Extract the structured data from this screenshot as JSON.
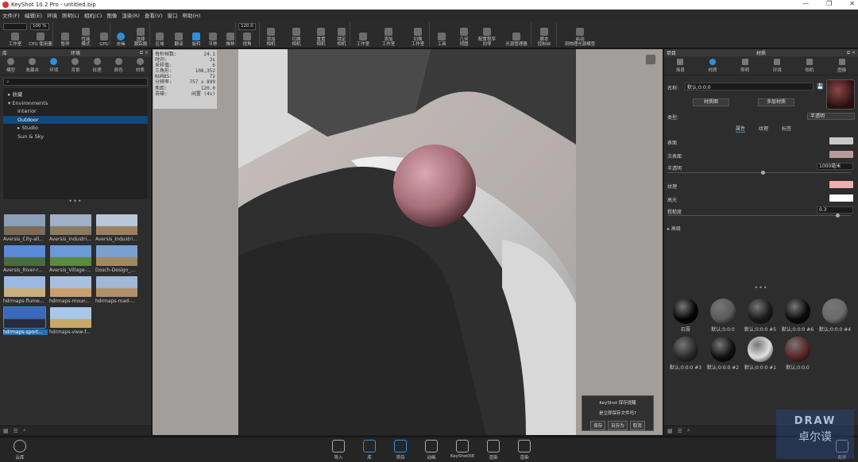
{
  "window": {
    "title": "KeyShot 10.2 Pro  -  untitled.bip",
    "controls": [
      "—",
      "❐",
      "✕"
    ]
  },
  "menu": [
    "文件(F)",
    "编辑(E)",
    "环境",
    "照明(L)",
    "相机(C)",
    "图像",
    "渲染(R)",
    "查看(V)",
    "窗口",
    "帮助(H)"
  ],
  "toolbar": {
    "fields": [
      "",
      "100 %",
      "120.0"
    ],
    "items": [
      {
        "label": "工作室"
      },
      {
        "label": "CPU 使用量"
      },
      {
        "label": "暂停"
      },
      {
        "label": "性能\n模式"
      },
      {
        "label": "GPU"
      },
      {
        "label": "去噪"
      },
      {
        "label": "选择\n跟踪器"
      },
      {
        "label": "区域"
      },
      {
        "label": "翻译"
      },
      {
        "label": "旋转"
      },
      {
        "label": "平移"
      },
      {
        "label": "推移"
      },
      {
        "label": "视角"
      },
      {
        "label": "添加\n相机"
      },
      {
        "label": "切换\n相机"
      },
      {
        "label": "重置\n相机"
      },
      {
        "label": "锁定\n相机"
      },
      {
        "label": "工作室"
      },
      {
        "label": "添加\n工作室"
      },
      {
        "label": "切换\n工作室"
      },
      {
        "label": "工具"
      },
      {
        "label": "几何\n视图"
      },
      {
        "label": "配置程序\n向导"
      },
      {
        "label": "光源管理器"
      },
      {
        "label": "脚本\n控制台"
      },
      {
        "label": "启动\n到物理光源模型"
      }
    ]
  },
  "library": {
    "title": "库",
    "section": "环境",
    "tabs": [
      {
        "label": "模型"
      },
      {
        "label": "收藏夹"
      },
      {
        "label": "环境"
      },
      {
        "label": "背景"
      },
      {
        "label": "纹理"
      },
      {
        "label": "颜色"
      },
      {
        "label": "材质"
      }
    ],
    "search_placeholder": "⌕",
    "tree": [
      {
        "label": "▸ 收藏",
        "level": 0
      },
      {
        "label": "▾ Environments",
        "level": 0
      },
      {
        "label": "Interior",
        "level": 1
      },
      {
        "label": "Outdoor",
        "level": 1,
        "selected": true
      },
      {
        "label": "▸ Studio",
        "level": 1
      },
      {
        "label": "Sun & Sky",
        "level": 1
      }
    ],
    "thumbnails": [
      {
        "label": "Aversis_City-all...",
        "colors": [
          "#8aa0b8",
          "#7a6a58"
        ]
      },
      {
        "label": "Aversis_Industri...",
        "colors": [
          "#9fb0c8",
          "#8a7a60"
        ]
      },
      {
        "label": "Aversis_Industri...",
        "colors": [
          "#b8c8d8",
          "#9a8060"
        ]
      },
      {
        "label": "Aversis_River-r...",
        "colors": [
          "#5a8ad8",
          "#4a6a40"
        ]
      },
      {
        "label": "Aversis_Village-...",
        "colors": [
          "#6a9ad8",
          "#5a8a40"
        ]
      },
      {
        "label": "Dosch-Design_...",
        "colors": [
          "#7aa0d0",
          "#a08a60"
        ]
      },
      {
        "label": "hdrmaps-flume...",
        "colors": [
          "#9ab8e0",
          "#c8b080"
        ]
      },
      {
        "label": "hdrmaps-moun...",
        "colors": [
          "#a8c0e0",
          "#c8a070"
        ]
      },
      {
        "label": "hdrmaps-road-...",
        "colors": [
          "#a0b8d8",
          "#b09068"
        ]
      },
      {
        "label": "hdrmaps-sport...",
        "colors": [
          "#3a6ab8",
          "#2a2a3a"
        ],
        "selected": true
      },
      {
        "label": "hdrmaps-view-f...",
        "colors": [
          "#a8c8e8",
          "#c8a868"
        ]
      }
    ]
  },
  "render_stats": [
    {
      "k": "每秒帧数:",
      "v": "24.1"
    },
    {
      "k": "时间:",
      "v": "3s"
    },
    {
      "k": "采样值:",
      "v": "6"
    },
    {
      "k": "三角形:",
      "v": "108,352"
    },
    {
      "k": "NURBS:",
      "v": "72"
    },
    {
      "k": "分辨率:",
      "v": "757 x 899"
    },
    {
      "k": "焦距:",
      "v": "120.0"
    },
    {
      "k": "去噪:",
      "v": "闲置 (4s)"
    }
  ],
  "dialog": {
    "title": "KeyShot 保存提醒",
    "message": "是立即保存文件吗?",
    "buttons": [
      "保存",
      "另存为",
      "取消"
    ]
  },
  "project": {
    "title": "项目",
    "section": "材质",
    "tabs": [
      {
        "label": "场景"
      },
      {
        "label": "材质"
      },
      {
        "label": "照明"
      },
      {
        "label": "环境"
      },
      {
        "label": "相机"
      },
      {
        "label": "图像"
      }
    ],
    "name_label": "名称:",
    "name_value": "默认;0:0:0",
    "btn_map": "材质图",
    "btn_multi": "多层材质",
    "type_label": "类型:",
    "type_value": "半透明",
    "subtabs": [
      "属性",
      "纹理",
      "标签"
    ],
    "props": [
      {
        "label": "表面",
        "color": "#c8c8c8"
      },
      {
        "label": "次表面",
        "color": "#b89a9a"
      },
      {
        "label": "半透明",
        "value": "1000毫米"
      },
      {
        "label": "纹理",
        "color": "#f0b0b0"
      },
      {
        "label": "高光",
        "color": "#ffffff"
      },
      {
        "label": "粗糙度",
        "value": "0.3"
      }
    ],
    "advanced": "▸ 高级",
    "materials": [
      {
        "label": "石膏",
        "color": "#050505"
      },
      {
        "label": "默认;0:0:0",
        "color": "#5a5a5a"
      },
      {
        "label": "默认;0:0:0 #5",
        "color": "#1a1a1a"
      },
      {
        "label": "默认;0:0:0 #6",
        "color": "#0a0a0a"
      },
      {
        "label": "默认;0:0:0 #4",
        "color": "#6a6a6a"
      },
      {
        "label": "默认;0:0:0 #3",
        "color": "#2a2a2a"
      },
      {
        "label": "默认;0:0:0 #2",
        "color": "#101010"
      },
      {
        "label": "默认;0:0:0 #1",
        "color": "#e0e0e0"
      },
      {
        "label": "默认;0:0:0",
        "color": "#5a2525"
      }
    ]
  },
  "bottombar": {
    "left": "云库",
    "items": [
      {
        "label": "导入"
      },
      {
        "label": "库",
        "active": true
      },
      {
        "label": "项目",
        "active": true
      },
      {
        "label": "动画"
      },
      {
        "label": "KeyShotXR"
      },
      {
        "label": "渲染"
      },
      {
        "label": "渲染"
      }
    ],
    "right": "截屏"
  },
  "watermark": {
    "line1": "DRAW",
    "line2": "卓尔谟"
  }
}
